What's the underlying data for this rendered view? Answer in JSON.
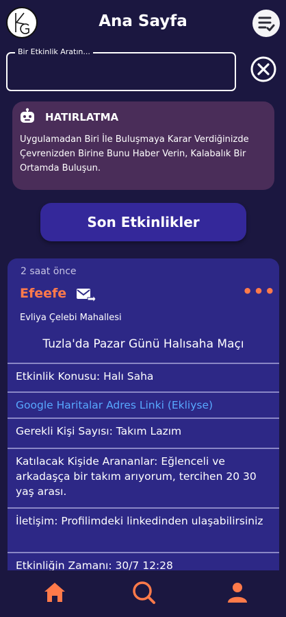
{
  "header": {
    "title": "Ana Sayfa",
    "logo_text": "KG",
    "sort_icon": "sort-list-icon"
  },
  "search": {
    "label": "Bir Etkinlik Aratın...",
    "value": "",
    "clear_icon": "close-circle-icon"
  },
  "reminder": {
    "icon": "robot-icon",
    "title": "HATIRLATMA",
    "text": "Uygulamadan Biri İle Buluşmaya Karar Verdiğinizde Çevrenizden Birine Bunu Haber Verin, Kalabalık Bir Ortamda Buluşun."
  },
  "recent_button": "Son Etkinlikler",
  "event": {
    "time_ago": "2 saat önce",
    "author": "Efeefe",
    "more": "•••",
    "district": "Evliya Çelebi Mahallesi",
    "title": "Tuzla'da Pazar Günü Halısaha Maçı",
    "rows": [
      "Etkinlik Konusu:  Halı Saha",
      "Google Haritalar Adres Linki (Ekliyse)",
      "Gerekli Kişi Sayısı:  Takım Lazım",
      "Katılacak Kişide Arananlar:  Eğlenceli ve arkadaşça bir takım arıyorum, tercihen 20 30 yaş arası.",
      "İletişim:  Profilimdeki linkedinden ulaşabilirsiniz",
      "Etkinliğin Zamanı:  30/7 12:28"
    ]
  },
  "nav": {
    "items": [
      "home-icon",
      "search-icon",
      "profile-icon"
    ],
    "active_color": "#ff7a4a"
  },
  "colors": {
    "background": "#1b1740",
    "card": "#2d2886",
    "accent": "#ff7a4a",
    "link": "#58a8ff",
    "reminder_bg": "#4a2d59",
    "button": "#34289a"
  }
}
